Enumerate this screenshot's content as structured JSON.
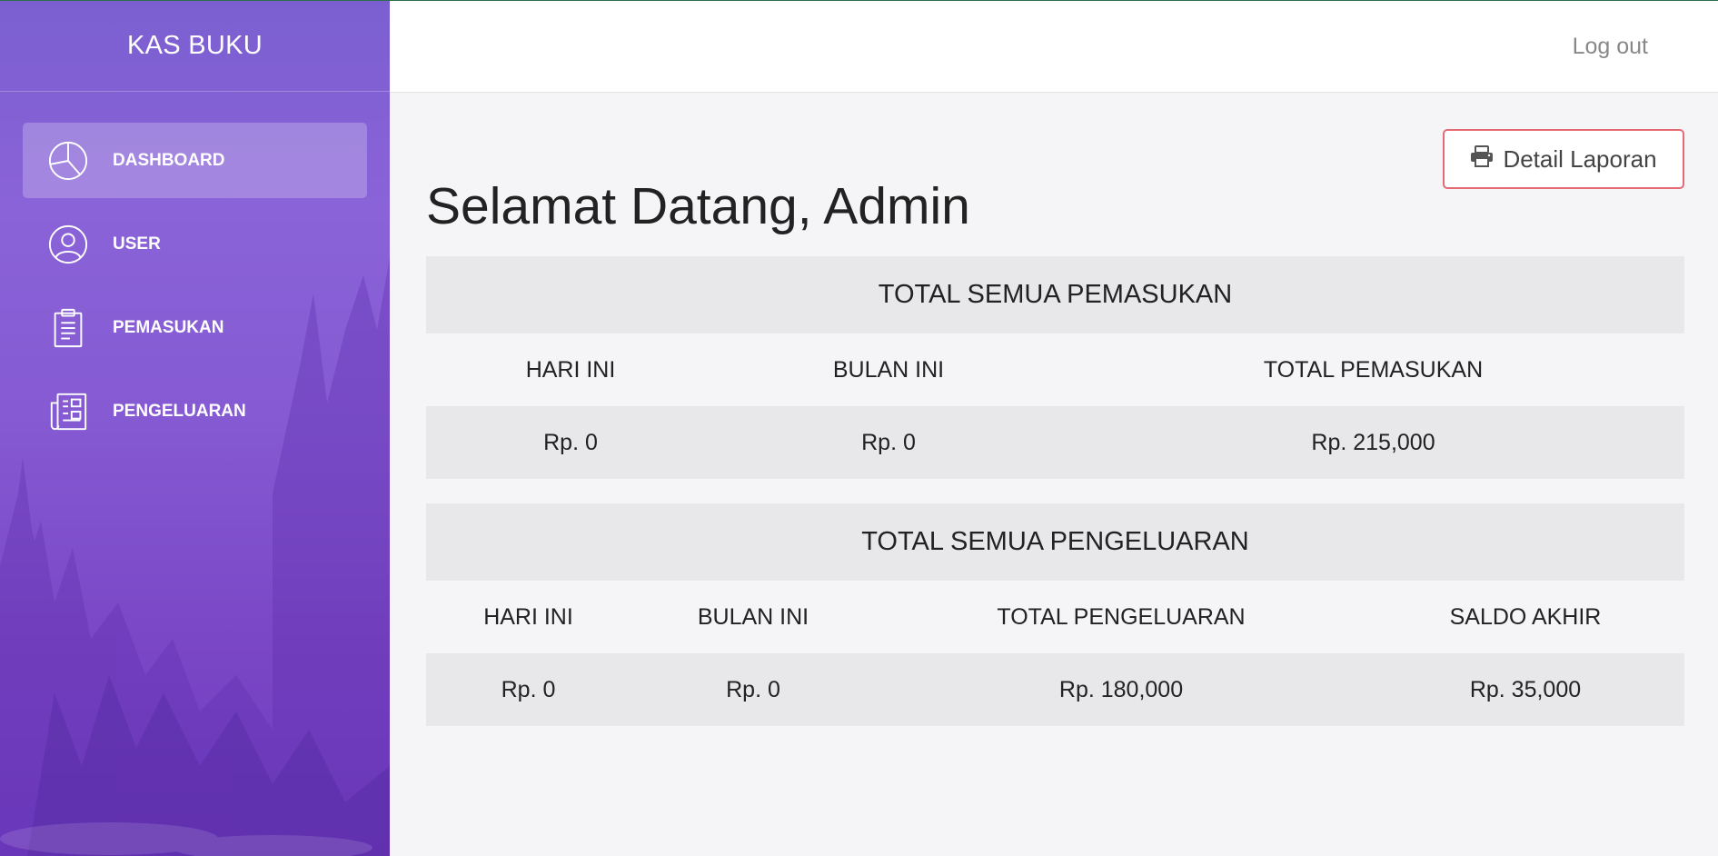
{
  "app": {
    "brand": "KAS BUKU",
    "logout_label": "Log out"
  },
  "sidebar": {
    "items": [
      {
        "label": "DASHBOARD",
        "icon": "pie-chart-icon",
        "active": true
      },
      {
        "label": "USER",
        "icon": "user-circle-icon",
        "active": false
      },
      {
        "label": "PEMASUKAN",
        "icon": "clipboard-icon",
        "active": false
      },
      {
        "label": "PENGELUARAN",
        "icon": "newspaper-icon",
        "active": false
      }
    ]
  },
  "main": {
    "title": "Selamat Datang, Admin",
    "detail_button": {
      "label": "Detail Laporan",
      "icon": "printer-icon"
    },
    "income": {
      "heading": "TOTAL SEMUA PEMASUKAN",
      "columns": [
        "HARI INI",
        "BULAN INI",
        "TOTAL PEMASUKAN"
      ],
      "values": [
        "Rp. 0",
        "Rp. 0",
        "Rp. 215,000"
      ]
    },
    "expense": {
      "heading": "TOTAL SEMUA PENGELUARAN",
      "columns": [
        "HARI INI",
        "BULAN INI",
        "TOTAL PENGELUARAN",
        "SALDO AKHIR"
      ],
      "values": [
        "Rp. 0",
        "Rp. 0",
        "Rp. 180,000",
        "Rp. 35,000"
      ]
    }
  },
  "colors": {
    "sidebar_top": "#7b5fd0",
    "sidebar_bottom": "#6f3bc0",
    "button_border": "#e56a72",
    "panel_bg": "#e8e8ea"
  }
}
